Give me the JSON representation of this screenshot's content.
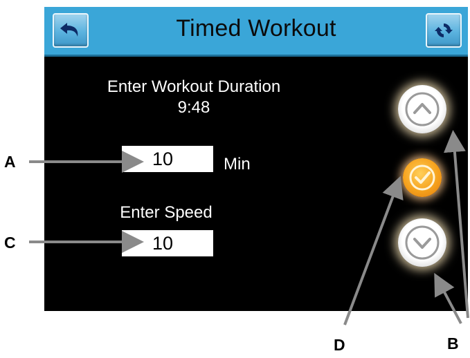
{
  "header": {
    "title": "Timed Workout",
    "back_icon": "undo-arrow-icon",
    "refresh_icon": "refresh-icon"
  },
  "duration": {
    "prompt": "Enter Workout Duration",
    "time": "9:48",
    "value": "10",
    "unit": "Min"
  },
  "speed": {
    "prompt": "Enter Speed",
    "value": "10"
  },
  "controls": {
    "up_icon": "chevron-up-icon",
    "confirm_icon": "checkmark-icon",
    "down_icon": "chevron-down-icon"
  },
  "annotations": {
    "a": "A",
    "b": "B",
    "c": "C",
    "d": "D"
  },
  "colors": {
    "header_bg": "#3aa6d8",
    "screen_bg": "#000000",
    "confirm_orange": "#f6a21d",
    "arrow_gray": "#8a8a8a"
  }
}
